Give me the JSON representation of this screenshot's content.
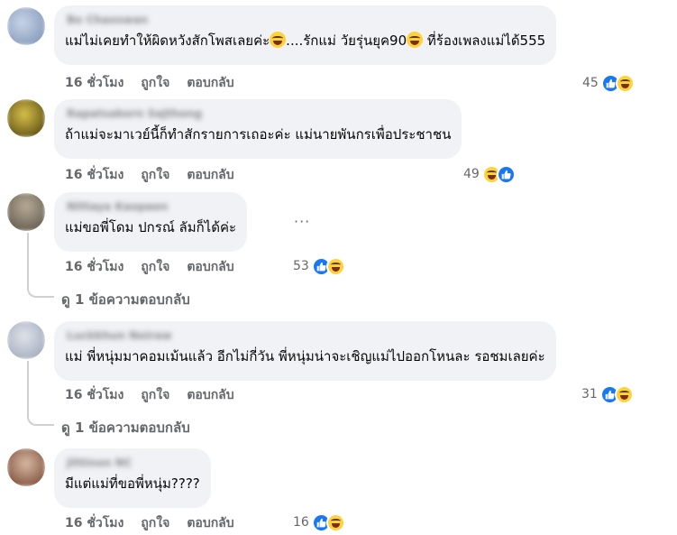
{
  "comments": [
    {
      "author": "Bo Chaoswan",
      "text_parts": [
        "แม่ไม่เคยทำให้ผิดหวังสักโพสเลยค่ะ",
        "....รักแม่ วัยรุ่นยุค90",
        " ที่ร้องเพลงแม่ได้555"
      ],
      "time": "16 ชั่วโมง",
      "like_label": "ถูกใจ",
      "reply_label": "ตอบกลับ",
      "reaction_count": "45",
      "reactions": [
        "like-icon",
        "haha-icon"
      ]
    },
    {
      "author": "Rapatsakorn Sajthong",
      "text": "ถ้าแม่จะมาเวย์นี้ก็ทำสักรายการเถอะค่ะ แม่นายพันกรเพื่อประชาชน",
      "time": "16 ชั่วโมง",
      "like_label": "ถูกใจ",
      "reply_label": "ตอบกลับ",
      "reaction_count": "49",
      "reactions": [
        "haha-icon",
        "like-icon"
      ]
    },
    {
      "author": "Nittaya Kaopaen",
      "text": "แม่ขอพี่โดม ปกรณ์ ลัมก็ได้ค่ะ",
      "time": "16 ชั่วโมง",
      "like_label": "ถูกใจ",
      "reply_label": "ตอบกลับ",
      "reaction_count": "53",
      "reactions": [
        "like-icon",
        "haha-icon"
      ],
      "more": "···",
      "view_replies": "ดู 1 ข้อความตอบกลับ"
    },
    {
      "author": "Luckkhun Noiraw",
      "text": "แม่ พี่หนุ่มมาคอมเม้นแล้ว อีกไม่กี่วัน พี่หนุ่มน่าจะเชิญแม่ไปออกโหนละ รอชมเลยค่ะ",
      "time": "16 ชั่วโมง",
      "like_label": "ถูกใจ",
      "reply_label": "ตอบกลับ",
      "reaction_count": "31",
      "reactions": [
        "like-icon",
        "haha-icon"
      ],
      "view_replies": "ดู 1 ข้อความตอบกลับ"
    },
    {
      "author": "Jittinon NC",
      "text": "มีแต่แม่ที่ขอพี่หนุ่ม????",
      "time": "16 ชั่วโมง",
      "like_label": "ถูกใจ",
      "reply_label": "ตอบกลับ",
      "reaction_count": "16",
      "reactions": [
        "like-icon",
        "haha-icon"
      ]
    }
  ],
  "colors": {
    "bubble": "#f0f2f5",
    "meta_text": "#65676b",
    "like_blue": "#1877f2",
    "haha_yellow": "#ffd23b"
  }
}
